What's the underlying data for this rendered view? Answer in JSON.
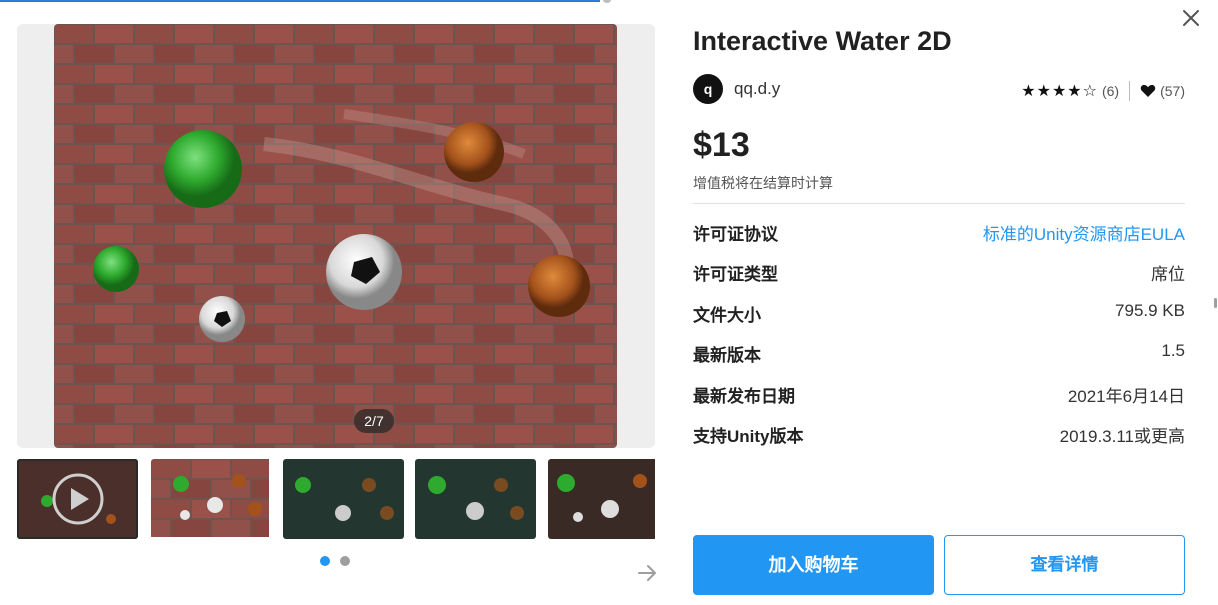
{
  "gallery": {
    "counter": "2/7",
    "thumbnails": [
      {
        "name": "thumb-video",
        "kind": "video",
        "active": true
      },
      {
        "name": "thumb-2",
        "kind": "image",
        "active": false
      },
      {
        "name": "thumb-3",
        "kind": "image",
        "active": false
      },
      {
        "name": "thumb-4",
        "kind": "image",
        "active": false
      },
      {
        "name": "thumb-5",
        "kind": "image",
        "active": false
      }
    ],
    "pagination": {
      "pages": 2,
      "current": 1
    },
    "video_icon": "play-icon"
  },
  "product": {
    "title": "Interactive Water 2D",
    "publisher_initial": "q",
    "publisher": "qq.d.y",
    "stars": "★★★★☆",
    "rating_count": "(6)",
    "favorites": "(57)",
    "price": "$13",
    "tax_note": "增值税将在结算时计算"
  },
  "details": [
    {
      "label": "许可证协议",
      "value": "标准的Unity资源商店EULA",
      "link": true
    },
    {
      "label": "许可证类型",
      "value": "席位",
      "link": false
    },
    {
      "label": "文件大小",
      "value": "795.9 KB",
      "link": false
    },
    {
      "label": "最新版本",
      "value": "1.5",
      "link": false
    },
    {
      "label": "最新发布日期",
      "value": "2021年6月14日",
      "link": false
    },
    {
      "label": "支持Unity版本",
      "value": "2019.3.11或更高",
      "link": false
    }
  ],
  "actions": {
    "add_to_cart": "加入购物车",
    "view_details": "查看详情"
  },
  "colors": {
    "accent": "#2196f3",
    "text": "#212121",
    "brick": "#8a4a40"
  }
}
